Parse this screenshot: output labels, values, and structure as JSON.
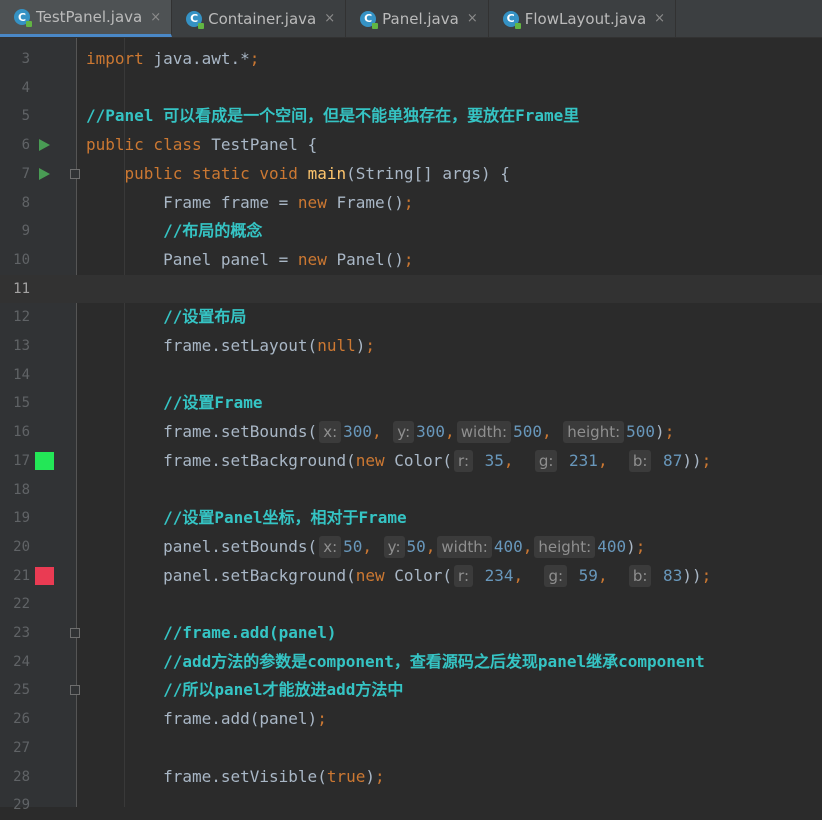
{
  "tabs": [
    {
      "label": "TestPanel.java",
      "active": true
    },
    {
      "label": "Container.java",
      "active": false
    },
    {
      "label": "Panel.java",
      "active": false
    },
    {
      "label": "FlowLayout.java",
      "active": false
    }
  ],
  "tab_icon": {
    "letter": "C",
    "close": "×"
  },
  "colors": {
    "background": "#2b2b2b",
    "keyword": "#cc7832",
    "comment": "#35c4c4",
    "number": "#6897bb",
    "method": "#ffc66d",
    "green_swatch": "#23e757",
    "red_swatch": "#ea3b53"
  },
  "lines": [
    {
      "n": "3",
      "parts": [
        {
          "c": "kw",
          "t": "import"
        },
        {
          "t": " java.awt.*"
        },
        {
          "c": "kw",
          "t": ";"
        }
      ]
    },
    {
      "n": "4",
      "parts": []
    },
    {
      "n": "5",
      "parts": [
        {
          "c": "cm",
          "t": "//Panel 可以看成是一个空间，但是不能单独存在，要放在Frame里"
        }
      ]
    },
    {
      "n": "6",
      "run": true,
      "parts": [
        {
          "c": "kw",
          "t": "public class "
        },
        {
          "t": "TestPanel {"
        }
      ]
    },
    {
      "n": "7",
      "run": true,
      "fold": true,
      "parts": [
        {
          "t": "    "
        },
        {
          "c": "kw",
          "t": "public static void "
        },
        {
          "c": "fn",
          "t": "main"
        },
        {
          "t": "(String[] args) {"
        }
      ]
    },
    {
      "n": "8",
      "parts": [
        {
          "t": "        Frame frame = "
        },
        {
          "c": "kw",
          "t": "new "
        },
        {
          "t": "Frame()"
        },
        {
          "c": "kw",
          "t": ";"
        }
      ]
    },
    {
      "n": "9",
      "parts": [
        {
          "t": "        "
        },
        {
          "c": "cm",
          "t": "//布局的概念"
        }
      ]
    },
    {
      "n": "10",
      "parts": [
        {
          "t": "        Panel panel = "
        },
        {
          "c": "kw",
          "t": "new "
        },
        {
          "t": "Panel()"
        },
        {
          "c": "kw",
          "t": ";"
        }
      ]
    },
    {
      "n": "11",
      "current": true,
      "parts": []
    },
    {
      "n": "12",
      "parts": [
        {
          "t": "        "
        },
        {
          "c": "cm",
          "t": "//设置布局"
        }
      ]
    },
    {
      "n": "13",
      "parts": [
        {
          "t": "        frame.setLayout("
        },
        {
          "c": "kw",
          "t": "null"
        },
        {
          "t": ")"
        },
        {
          "c": "kw",
          "t": ";"
        }
      ]
    },
    {
      "n": "14",
      "parts": []
    },
    {
      "n": "15",
      "parts": [
        {
          "t": "        "
        },
        {
          "c": "cm",
          "t": "//设置Frame"
        }
      ]
    },
    {
      "n": "16",
      "parts": [
        {
          "t": "        frame.setBounds("
        },
        {
          "c": "hint",
          "t": "x:"
        },
        {
          "c": "num",
          "t": "300"
        },
        {
          "c": "kw",
          "t": ", "
        },
        {
          "c": "hint",
          "t": "y:"
        },
        {
          "c": "num",
          "t": "300"
        },
        {
          "c": "kw",
          "t": ","
        },
        {
          "c": "hint",
          "t": "width:"
        },
        {
          "c": "num",
          "t": "500"
        },
        {
          "c": "kw",
          "t": ", "
        },
        {
          "c": "hint",
          "t": "height:"
        },
        {
          "c": "num",
          "t": "500"
        },
        {
          "t": ")"
        },
        {
          "c": "kw",
          "t": ";"
        }
      ]
    },
    {
      "n": "17",
      "swatch": "green",
      "parts": [
        {
          "t": "        frame.setBackground("
        },
        {
          "c": "kw",
          "t": "new "
        },
        {
          "t": "Color("
        },
        {
          "c": "hint",
          "t": "r:"
        },
        {
          "c": "num",
          "t": " 35"
        },
        {
          "c": "kw",
          "t": ",  "
        },
        {
          "c": "hint",
          "t": "g:"
        },
        {
          "c": "num",
          "t": " 231"
        },
        {
          "c": "kw",
          "t": ",  "
        },
        {
          "c": "hint",
          "t": "b:"
        },
        {
          "c": "num",
          "t": " 87"
        },
        {
          "t": "))"
        },
        {
          "c": "kw",
          "t": ";"
        }
      ]
    },
    {
      "n": "18",
      "parts": []
    },
    {
      "n": "19",
      "parts": [
        {
          "t": "        "
        },
        {
          "c": "cm",
          "t": "//设置Panel坐标，相对于Frame"
        }
      ]
    },
    {
      "n": "20",
      "parts": [
        {
          "t": "        panel.setBounds("
        },
        {
          "c": "hint",
          "t": "x:"
        },
        {
          "c": "num",
          "t": "50"
        },
        {
          "c": "kw",
          "t": ", "
        },
        {
          "c": "hint",
          "t": "y:"
        },
        {
          "c": "num",
          "t": "50"
        },
        {
          "c": "kw",
          "t": ","
        },
        {
          "c": "hint",
          "t": "width:"
        },
        {
          "c": "num",
          "t": "400"
        },
        {
          "c": "kw",
          "t": ","
        },
        {
          "c": "hint",
          "t": "height:"
        },
        {
          "c": "num",
          "t": "400"
        },
        {
          "t": ")"
        },
        {
          "c": "kw",
          "t": ";"
        }
      ]
    },
    {
      "n": "21",
      "swatch": "red",
      "parts": [
        {
          "t": "        panel.setBackground("
        },
        {
          "c": "kw",
          "t": "new "
        },
        {
          "t": "Color("
        },
        {
          "c": "hint",
          "t": "r:"
        },
        {
          "c": "num",
          "t": " 234"
        },
        {
          "c": "kw",
          "t": ",  "
        },
        {
          "c": "hint",
          "t": "g:"
        },
        {
          "c": "num",
          "t": " 59"
        },
        {
          "c": "kw",
          "t": ",  "
        },
        {
          "c": "hint",
          "t": "b:"
        },
        {
          "c": "num",
          "t": " 83"
        },
        {
          "t": "))"
        },
        {
          "c": "kw",
          "t": ";"
        }
      ]
    },
    {
      "n": "22",
      "parts": []
    },
    {
      "n": "23",
      "fold": true,
      "parts": [
        {
          "t": "        "
        },
        {
          "c": "cm",
          "t": "//frame.add(panel)"
        }
      ]
    },
    {
      "n": "24",
      "parts": [
        {
          "t": "        "
        },
        {
          "c": "cm",
          "t": "//add方法的参数是component，查看源码之后发现panel继承component"
        }
      ]
    },
    {
      "n": "25",
      "fold": true,
      "parts": [
        {
          "t": "        "
        },
        {
          "c": "cm",
          "t": "//所以panel才能放进add方法中"
        }
      ]
    },
    {
      "n": "26",
      "parts": [
        {
          "t": "        frame.add(panel)"
        },
        {
          "c": "kw",
          "t": ";"
        }
      ]
    },
    {
      "n": "27",
      "parts": []
    },
    {
      "n": "28",
      "parts": [
        {
          "t": "        frame.setVisible("
        },
        {
          "c": "kw",
          "t": "true"
        },
        {
          "t": ")"
        },
        {
          "c": "kw",
          "t": ";"
        }
      ]
    },
    {
      "n": "29",
      "parts": []
    }
  ]
}
